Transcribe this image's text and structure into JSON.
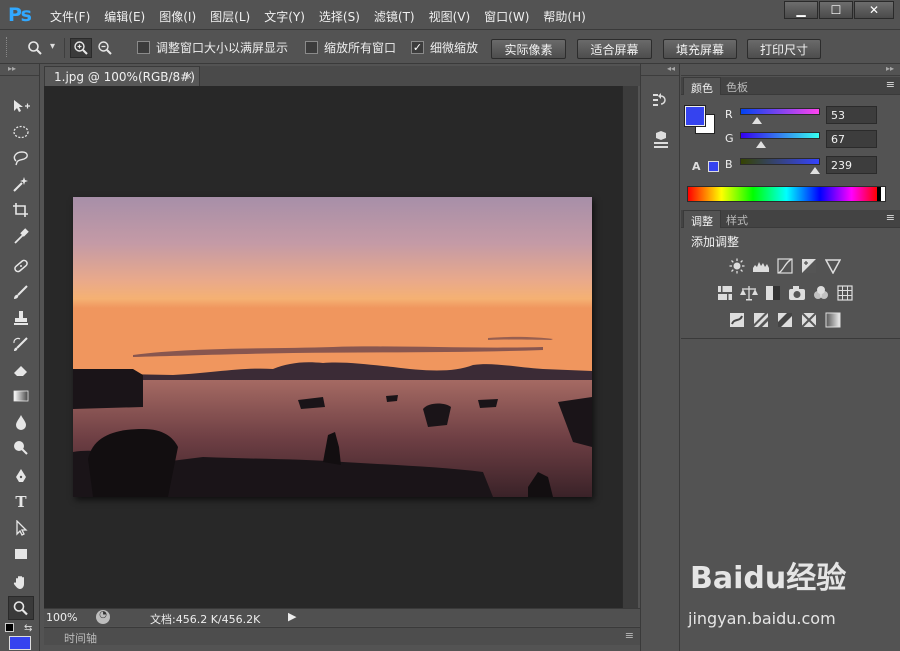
{
  "app": {
    "logo": "Ps"
  },
  "menu": [
    "文件(F)",
    "编辑(E)",
    "图像(I)",
    "图层(L)",
    "文字(Y)",
    "选择(S)",
    "滤镜(T)",
    "视图(V)",
    "窗口(W)",
    "帮助(H)"
  ],
  "window_controls": {
    "minimize": "▁",
    "maximize": "☐",
    "close": "✕"
  },
  "options_bar": {
    "checkbox1": {
      "label": "调整窗口大小以满屏显示",
      "checked": false
    },
    "checkbox2": {
      "label": "缩放所有窗口",
      "checked": false
    },
    "checkbox3": {
      "label": "细微缩放",
      "checked": true,
      "mark": "✓"
    },
    "btn_actual": "实际像素",
    "btn_fit": "适合屏幕",
    "btn_fill": "填充屏幕",
    "btn_print": "打印尺寸",
    "dropdown_arrow": "▾"
  },
  "toolbar": {
    "collapse": "▸▸",
    "tools": [
      {
        "name": "move-tool",
        "icon": "move-icon"
      },
      {
        "name": "marquee-tool",
        "icon": "ellipse-marquee-icon"
      },
      {
        "name": "lasso-tool",
        "icon": "lasso-icon"
      },
      {
        "name": "magic-wand-tool",
        "icon": "magic-wand-icon"
      },
      {
        "name": "crop-tool",
        "icon": "crop-icon"
      },
      {
        "name": "eyedropper-tool",
        "icon": "eyedropper-icon"
      },
      {
        "name": "healing-brush-tool",
        "icon": "bandage-icon"
      },
      {
        "name": "brush-tool",
        "icon": "brush-icon"
      },
      {
        "name": "clone-stamp-tool",
        "icon": "stamp-icon"
      },
      {
        "name": "history-brush-tool",
        "icon": "history-brush-icon"
      },
      {
        "name": "eraser-tool",
        "icon": "eraser-icon"
      },
      {
        "name": "gradient-tool",
        "icon": "gradient-icon"
      },
      {
        "name": "blur-tool",
        "icon": "blur-drop-icon"
      },
      {
        "name": "dodge-tool",
        "icon": "dodge-icon"
      },
      {
        "name": "pen-tool",
        "icon": "pen-icon"
      },
      {
        "name": "type-tool",
        "icon": "type-icon",
        "glyph": "T"
      },
      {
        "name": "path-selection-tool",
        "icon": "arrow-icon"
      },
      {
        "name": "rectangle-tool",
        "icon": "rectangle-icon"
      },
      {
        "name": "hand-tool",
        "icon": "hand-icon"
      },
      {
        "name": "zoom-tool",
        "icon": "zoom-icon",
        "active": true
      }
    ]
  },
  "document": {
    "tab_title": "1.jpg @ 100%(RGB/8#)",
    "tab_close": "×",
    "zoom": "100%",
    "doc_info": "文档:456.2 K/456.2K",
    "play": "▶",
    "timeline_label": "时间轴"
  },
  "panels": {
    "collapse": "◂◂",
    "menu_icon": "≡",
    "color_tab": "颜色",
    "swatches_tab": "色板",
    "fg_color": "#3543ef",
    "bg_color": "#ffffff",
    "channels": [
      {
        "label": "R",
        "value": "53",
        "fraction": 0.208
      },
      {
        "label": "G",
        "value": "67",
        "fraction": 0.263
      },
      {
        "label": "B",
        "value": "239",
        "fraction": 0.937
      }
    ],
    "warning_glyph": "A",
    "adjust_tab": "调整",
    "styles_tab": "样式",
    "add_adjustment": "添加调整"
  },
  "watermark": {
    "brand": "Baidu经验",
    "url": "jingyan.baidu.com"
  }
}
